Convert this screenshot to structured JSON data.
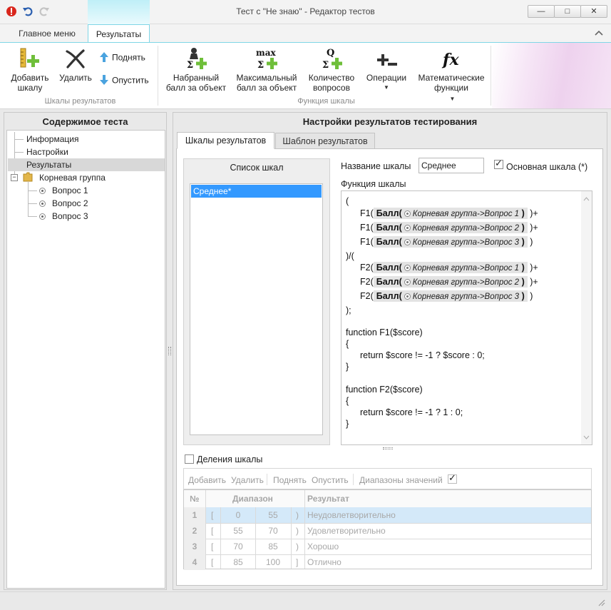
{
  "window": {
    "title": "Тест с \"Не знаю\" - Редактор тестов",
    "min_label": "—",
    "max_label": "□",
    "close_label": "✕"
  },
  "tabs": [
    {
      "label": "Главное меню"
    },
    {
      "label": "Результаты"
    }
  ],
  "ribbon": {
    "groups": [
      {
        "caption": "Шкалы результатов"
      },
      {
        "caption": "Функция шкалы"
      }
    ],
    "add_scale": "Добавить\nшкалу",
    "delete": "Удалить",
    "raise": "Поднять",
    "lower": "Опустить",
    "gained_score": "Набранный\nбалл за объект",
    "max_score": "Максимальный\nбалл за объект",
    "question_count": "Количество\nвопросов",
    "operations": "Операции",
    "math_functions": "Математические\nфункции",
    "icon_max_text": "max",
    "icon_q_text": "Q",
    "icon_fx_text": "fx",
    "sigma": "Σ"
  },
  "left": {
    "header": "Содержимое теста",
    "tree": [
      {
        "label": "Информация"
      },
      {
        "label": "Настройки"
      },
      {
        "label": "Результаты"
      },
      {
        "label": "Корневая группа"
      },
      {
        "label": "Вопрос 1"
      },
      {
        "label": "Вопрос 2"
      },
      {
        "label": "Вопрос 3"
      }
    ]
  },
  "right": {
    "header": "Настройки результатов тестирования",
    "tabs": [
      {
        "label": "Шкалы результатов"
      },
      {
        "label": "Шаблон результатов"
      }
    ],
    "scale_list_header": "Список шкал",
    "scale_list": [
      "Среднее*"
    ],
    "scale_name_label": "Название шкалы",
    "scale_name_value": "Среднее",
    "main_scale_label": "Основная шкала (*)",
    "main_scale_checked": true,
    "function_label": "Функция шкалы",
    "code": {
      "open": "(",
      "f1": "F1(",
      "f2": "F2(",
      "score": "Балл(",
      "close_paren": ")",
      "plus": ")+",
      "end1": ")",
      "div": ")/(",
      "end": ");",
      "paths": [
        "Корневая группа->Вопрос 1",
        "Корневая группа->Вопрос 2",
        "Корневая группа->Вопрос 3"
      ],
      "fn1_decl": "function F1($score)",
      "fn2_decl": "function F2($score)",
      "brace_open": "{",
      "brace_close": "}",
      "fn1_body": "return $score != -1 ? $score : 0;",
      "fn2_body": "return $score != -1 ? 1 : 0;"
    },
    "divisions_label": "Деления шкалы",
    "divisions_checked": false,
    "toolbar": {
      "add": "Добавить",
      "delete": "Удалить",
      "raise": "Поднять",
      "lower": "Опустить",
      "ranges": "Диапазоны значений",
      "ranges_checked": true
    },
    "grid": {
      "headers": [
        "№",
        "Диапазон",
        "Результат"
      ],
      "rows": [
        {
          "n": "1",
          "lb": "[",
          "from": "0",
          "to": "55",
          "rb": ")",
          "result": "Неудовлетворительно"
        },
        {
          "n": "2",
          "lb": "[",
          "from": "55",
          "to": "70",
          "rb": ")",
          "result": "Удовлетворительно"
        },
        {
          "n": "3",
          "lb": "[",
          "from": "70",
          "to": "85",
          "rb": ")",
          "result": "Хорошо"
        },
        {
          "n": "4",
          "lb": "[",
          "from": "85",
          "to": "100",
          "rb": "]",
          "result": "Отлично"
        }
      ]
    }
  },
  "colors": {
    "accent": "#7fd6e6",
    "selection": "#3399ff",
    "selected_row": "#d4e9f9",
    "add_green": "#6fbf3a"
  }
}
